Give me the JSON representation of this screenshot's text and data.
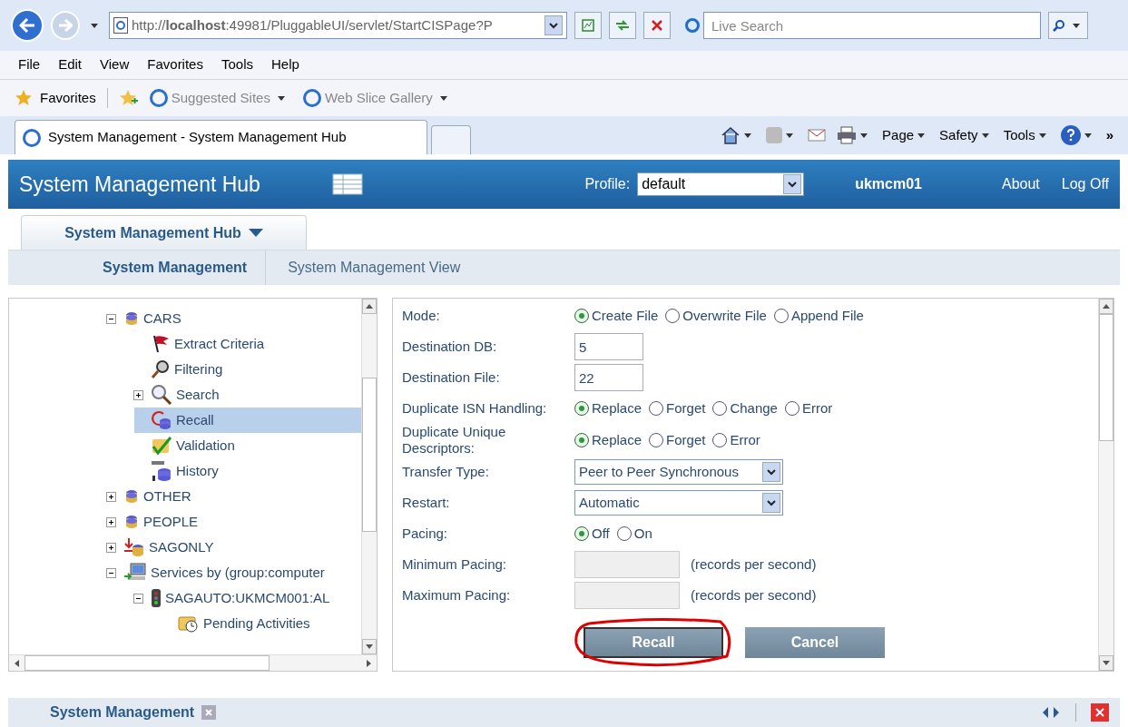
{
  "browser": {
    "address": "http://**localhost**:49981/PluggableUI/servlet/StartCISPage?P",
    "search_placeholder": "Live Search",
    "menu": [
      "File",
      "Edit",
      "View",
      "Favorites",
      "Tools",
      "Help"
    ],
    "favorites_label": "Favorites",
    "favorites": [
      {
        "label": "Suggested Sites"
      },
      {
        "label": "Web Slice Gallery"
      }
    ],
    "tab": "System Management - System Management Hub",
    "commands": [
      "Page",
      "Safety",
      "Tools"
    ],
    "more": "»"
  },
  "header": {
    "title": "System Management Hub",
    "profile_label": "Profile:",
    "profile_value": "default",
    "user": "ukmcm01",
    "links": [
      "About",
      "Log Off"
    ]
  },
  "hub_tab": "System Management Hub",
  "subnav": [
    {
      "label": "System Management",
      "selected": true
    },
    {
      "label": "System Management View",
      "selected": false
    }
  ],
  "tree": {
    "items": [
      {
        "children": [
          {
            "children": [
              {
                "label": "CARS",
                "kind": "database",
                "expanded": true,
                "selected": false,
                "children": [
                  {
                    "label": "Extract Criteria",
                    "kind": "flag",
                    "selected": false
                  },
                  {
                    "label": "Filtering",
                    "kind": "filter",
                    "selected": false
                  },
                  {
                    "label": "Search",
                    "kind": "search",
                    "expanded": false,
                    "selected": false
                  },
                  {
                    "label": "Recall",
                    "kind": "recall",
                    "selected": true
                  },
                  {
                    "label": "Validation",
                    "kind": "validation",
                    "selected": false
                  },
                  {
                    "label": "History",
                    "kind": "history",
                    "selected": false
                  }
                ]
              },
              {
                "label": "OTHER",
                "kind": "database",
                "expanded": false,
                "selected": false
              },
              {
                "label": "PEOPLE",
                "kind": "database",
                "expanded": false,
                "selected": false
              }
            ]
          },
          {
            "label": "SAGONLY",
            "kind": "sagonly",
            "expanded": false,
            "selected": false
          }
        ]
      },
      {
        "label": "Services by (group:computer",
        "kind": "computer",
        "expanded": true,
        "selected": false,
        "children": [
          {
            "label": "SAGAUTO:UKMCM001:AL",
            "kind": "traffic",
            "expanded": true,
            "selected": false,
            "children": [
              {
                "label": "Pending Activities",
                "kind": "pending",
                "selected": false
              }
            ]
          }
        ]
      }
    ]
  },
  "form": {
    "rows": [
      {
        "kind": "radio",
        "label": "Mode:",
        "options": [
          {
            "label": "Create File",
            "selected": true
          },
          {
            "label": "Overwrite File",
            "selected": false
          },
          {
            "label": "Append File",
            "selected": false
          }
        ]
      },
      {
        "kind": "text",
        "label": "Destination DB:",
        "value": "5"
      },
      {
        "kind": "text",
        "label": "Destination File:",
        "value": "22"
      },
      {
        "kind": "radio",
        "label": "Duplicate ISN Handling:",
        "options": [
          {
            "label": "Replace",
            "selected": true
          },
          {
            "label": "Forget",
            "selected": false
          },
          {
            "label": "Change",
            "selected": false
          },
          {
            "label": "Error",
            "selected": false
          }
        ]
      },
      {
        "kind": "radio",
        "label": "Duplicate Unique Descriptors:",
        "options": [
          {
            "label": "Replace",
            "selected": true
          },
          {
            "label": "Forget",
            "selected": false
          },
          {
            "label": "Error",
            "selected": false
          }
        ]
      },
      {
        "kind": "select",
        "label": "Transfer Type:",
        "value": "Peer to Peer Synchronous"
      },
      {
        "kind": "select",
        "label": "Restart:",
        "value": "Automatic"
      },
      {
        "kind": "radio",
        "label": "Pacing:",
        "options": [
          {
            "label": "Off",
            "selected": true
          },
          {
            "label": "On",
            "selected": false
          }
        ]
      },
      {
        "kind": "disabled",
        "label": "Minimum Pacing:",
        "suffix": "(records per second)"
      },
      {
        "kind": "disabled",
        "label": "Maximum Pacing:",
        "suffix": "(records per second)"
      }
    ],
    "buttons": [
      {
        "label": "Recall",
        "circled": true
      },
      {
        "label": "Cancel",
        "circled": false
      }
    ]
  },
  "bottom_tab": "System Management"
}
